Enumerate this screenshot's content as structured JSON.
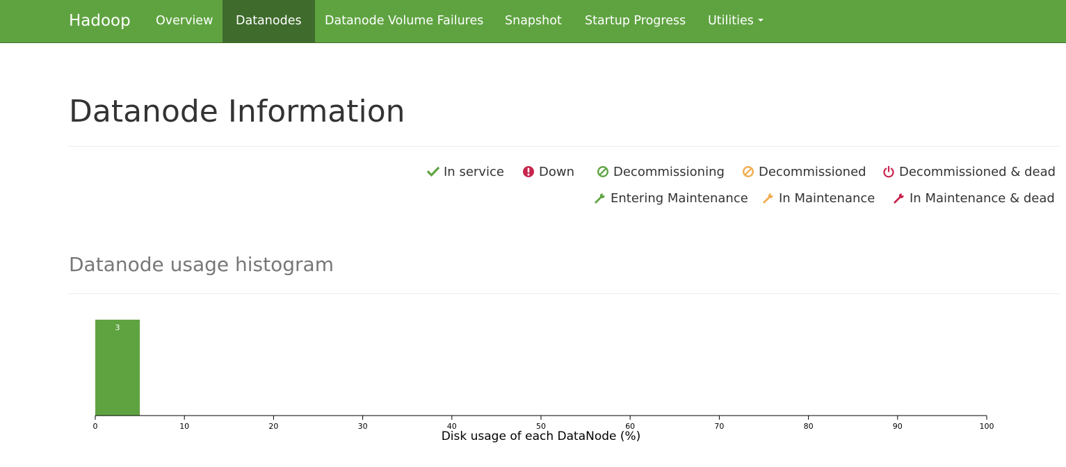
{
  "navbar": {
    "brand": "Hadoop",
    "items": [
      {
        "label": "Overview"
      },
      {
        "label": "Datanodes"
      },
      {
        "label": "Datanode Volume Failures"
      },
      {
        "label": "Snapshot"
      },
      {
        "label": "Startup Progress"
      },
      {
        "label": "Utilities"
      }
    ]
  },
  "page": {
    "title": "Datanode Information"
  },
  "legend": {
    "items": [
      {
        "label": "In service",
        "icon": "check-icon",
        "color": "#5fa341"
      },
      {
        "label": "Down",
        "icon": "exclamation-circle-icon",
        "color": "#c7254e"
      },
      {
        "label": "Decommissioning",
        "icon": "ban-icon",
        "color": "#5fa341"
      },
      {
        "label": "Decommissioned",
        "icon": "ban-icon",
        "color": "#f0ad4e"
      },
      {
        "label": "Decommissioned & dead",
        "icon": "power-icon",
        "color": "#c7254e"
      },
      {
        "label": "Entering Maintenance",
        "icon": "wrench-icon",
        "color": "#5fa341"
      },
      {
        "label": "In Maintenance",
        "icon": "wrench-icon",
        "color": "#f0ad4e"
      },
      {
        "label": "In Maintenance & dead",
        "icon": "wrench-icon",
        "color": "#c7254e"
      }
    ]
  },
  "histogram": {
    "title": "Datanode usage histogram"
  },
  "chart_data": {
    "type": "bar",
    "xlabel": "Disk usage of each DataNode (%)",
    "ylabel": "",
    "xlim": [
      0,
      100
    ],
    "xticks": [
      0,
      10,
      20,
      30,
      40,
      50,
      60,
      70,
      80,
      90,
      100
    ],
    "bins": [
      {
        "x0": 0,
        "x1": 5,
        "count": 3
      }
    ],
    "bar_color": "#5fa341",
    "grid": false
  }
}
